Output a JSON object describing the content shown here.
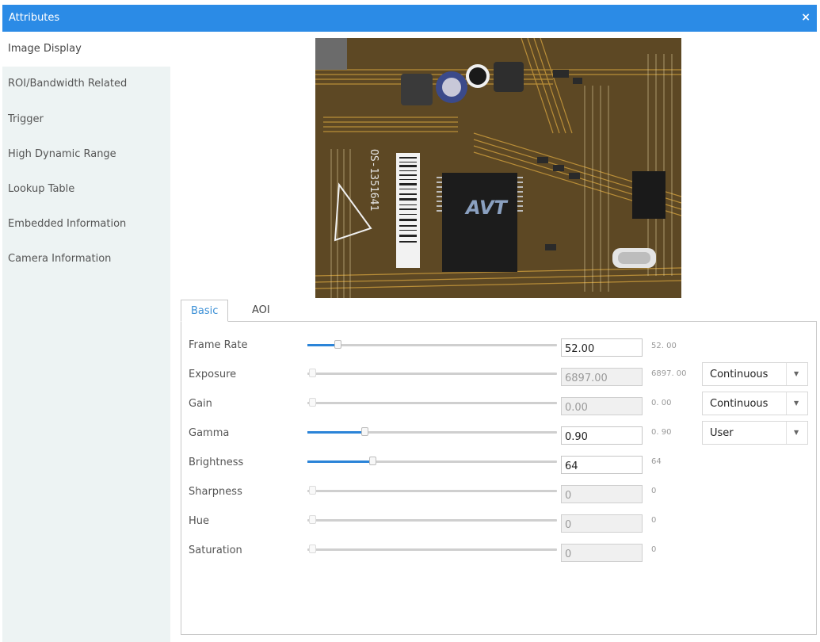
{
  "window": {
    "title": "Attributes",
    "close_glyph": "×"
  },
  "sidebar": {
    "items": [
      {
        "label": "Image Display",
        "active": true
      },
      {
        "label": "ROI/Bandwidth Related",
        "active": false
      },
      {
        "label": "Trigger",
        "active": false
      },
      {
        "label": "High Dynamic Range",
        "active": false
      },
      {
        "label": "Lookup Table",
        "active": false
      },
      {
        "label": "Embedded Information",
        "active": false
      },
      {
        "label": "Camera Information",
        "active": false
      }
    ]
  },
  "preview": {
    "chip_label": "AVT",
    "board_text": "OS-1351641"
  },
  "tabs": [
    {
      "label": "Basic",
      "active": true
    },
    {
      "label": "AOI",
      "active": false
    }
  ],
  "params": [
    {
      "label": "Frame Rate",
      "value": "52.00",
      "readout": "52. 00",
      "level": 0.12,
      "enabled": true,
      "mode": ""
    },
    {
      "label": "Exposure",
      "value": "6897.00",
      "readout": "6897. 00",
      "level": 0.0,
      "enabled": false,
      "mode": "Continuous"
    },
    {
      "label": "Gain",
      "value": "0.00",
      "readout": "0. 00",
      "level": 0.0,
      "enabled": false,
      "mode": "Continuous"
    },
    {
      "label": "Gamma",
      "value": "0.90",
      "readout": "0. 90",
      "level": 0.23,
      "enabled": true,
      "mode": "User"
    },
    {
      "label": "Brightness",
      "value": "64",
      "readout": "64",
      "level": 0.26,
      "enabled": true,
      "mode": ""
    },
    {
      "label": "Sharpness",
      "value": "0",
      "readout": "0",
      "level": 0.0,
      "enabled": false,
      "mode": ""
    },
    {
      "label": "Hue",
      "value": "0",
      "readout": "0",
      "level": 0.0,
      "enabled": false,
      "mode": ""
    },
    {
      "label": "Saturation",
      "value": "0",
      "readout": "0",
      "level": 0.0,
      "enabled": false,
      "mode": ""
    }
  ],
  "colors": {
    "accent": "#2b8be6",
    "sidebar_bg": "#edf3f3",
    "slider_fill": "#2b84d8"
  }
}
